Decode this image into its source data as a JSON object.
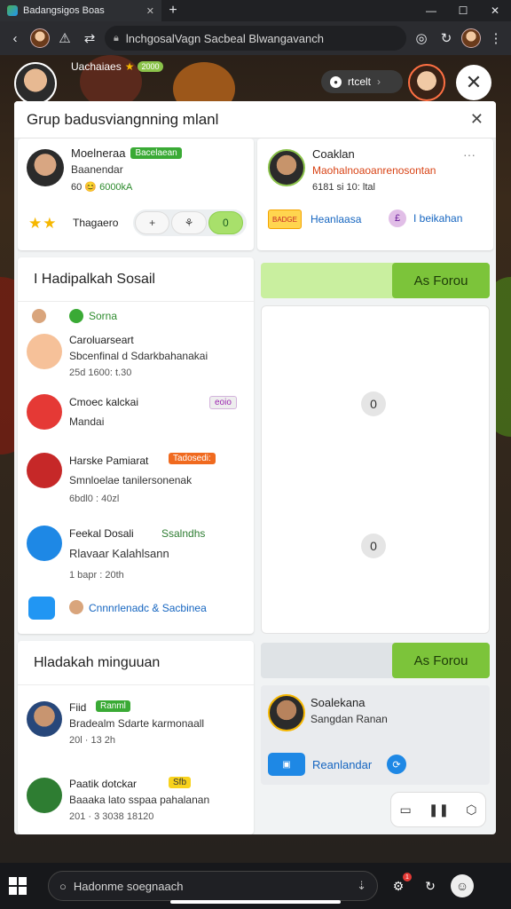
{
  "browser": {
    "tab_title": "Badangsigos Boas",
    "new_tab": "+",
    "address": "lnchgosalVagn Sacbeal Blwangavanch"
  },
  "background": {
    "host_name": "Uachaiaes",
    "host_badge": "2000",
    "pill_label": "rtcelt"
  },
  "modal": {
    "title": "Grup badusviangnning mlanl",
    "profile": {
      "name": "Moelneraa",
      "badge": "Bacelaean",
      "subtitle": "Baanendar",
      "meta_prefix": "60",
      "meta_value": "6000kA",
      "stars": "★★",
      "label": "Thagaero",
      "seg_left": "+",
      "seg_mid": "⚘",
      "seg_right": "0"
    },
    "social": {
      "title": "I Hadipalkah Sosail",
      "items": [
        {
          "text": "Sorna",
          "sub": "",
          "meta": ""
        },
        {
          "text": "Caroluarseart",
          "sub": "Sbcenfinal d Sdarkbahanakai",
          "meta": "25d 1600: t.30"
        },
        {
          "text": "Cmoec kalckai",
          "sub": "Mandai",
          "meta": "",
          "badge": "eoio"
        },
        {
          "text": "Harske Pamiarat",
          "sub": "Smnloelae tanilersonenak",
          "meta": "6bdl0 : 40zl",
          "badge": "Tadosedi:"
        },
        {
          "text": "Feekal Dosali",
          "sub": "Rlavaar Kalahlsann",
          "meta": "1 bapr : 20th",
          "badge": "Ssalndhs"
        },
        {
          "text": "Cnnnrlenadc & Sacbinea",
          "sub": "",
          "meta": ""
        }
      ]
    },
    "minimum": {
      "title": "Hladakah minguuan",
      "items": [
        {
          "text": "Fiid",
          "badge": "Ranml",
          "sub": "Bradealm Sdarte karmonaall",
          "meta": "20l · 13 2h"
        },
        {
          "text": "Paatik dotckar",
          "badge": "Sfb",
          "sub": "Baaaka lato sspaa pahalanan",
          "meta": "201 · 3 3038 18120"
        }
      ]
    },
    "right_profile": {
      "name": "Coaklan",
      "subtitle": "Maohalnoaoanrenosontan",
      "meta": "6181 si 10: ltal",
      "more": "···",
      "link_a": "Heanlaasa",
      "link_a_icon": "BADGE",
      "link_b": "I beikahan",
      "link_b_icon": "£"
    },
    "green_btn_1": "As Forou",
    "zero_a": "0",
    "zero_b": "0",
    "green_btn_2": "As Forou",
    "right_small": {
      "name": "Soalekana",
      "subtitle": "Sangdan Ranan",
      "link": "Reanlandar",
      "link_icon": "▣"
    },
    "controls": [
      "▭",
      "❚❚",
      "⬡"
    ]
  },
  "taskbar": {
    "search_placeholder": "Hadonme soegnaach",
    "notif_count": "1"
  }
}
